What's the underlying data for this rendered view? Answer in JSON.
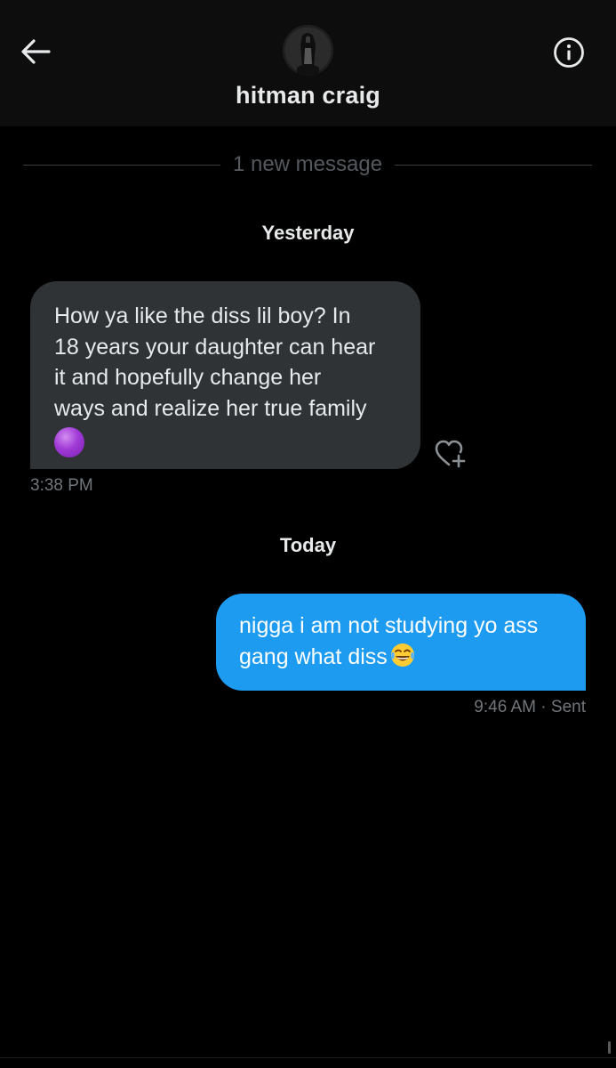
{
  "header": {
    "contact_name": "hitman craig",
    "back_icon": "arrow-left-icon",
    "info_icon": "info-circle-icon"
  },
  "divider": {
    "text": "1 new message"
  },
  "sections": [
    {
      "date_label": "Yesterday",
      "message": {
        "direction": "incoming",
        "lines": [
          "How ya like the diss lil boy? In",
          "18 years your daughter can hear",
          "it and hopefully change her",
          "ways and realize her true family"
        ],
        "emoji": "purple-circle",
        "time": "3:38 PM",
        "react_icon": "heart-plus-icon"
      }
    },
    {
      "date_label": "Today",
      "message": {
        "direction": "outgoing",
        "lines": [
          "nigga i am not studying yo ass",
          "gang what diss"
        ],
        "emoji": "tears-of-joy",
        "time": "9:46 AM",
        "status": "· Sent"
      }
    }
  ],
  "colors": {
    "background": "#000000",
    "header_bg": "#0d0d0d",
    "incoming_bubble": "#2f3336",
    "outgoing_bubble": "#1d9bf0",
    "muted_text": "#71767b",
    "primary_text": "#e7e9ea"
  }
}
